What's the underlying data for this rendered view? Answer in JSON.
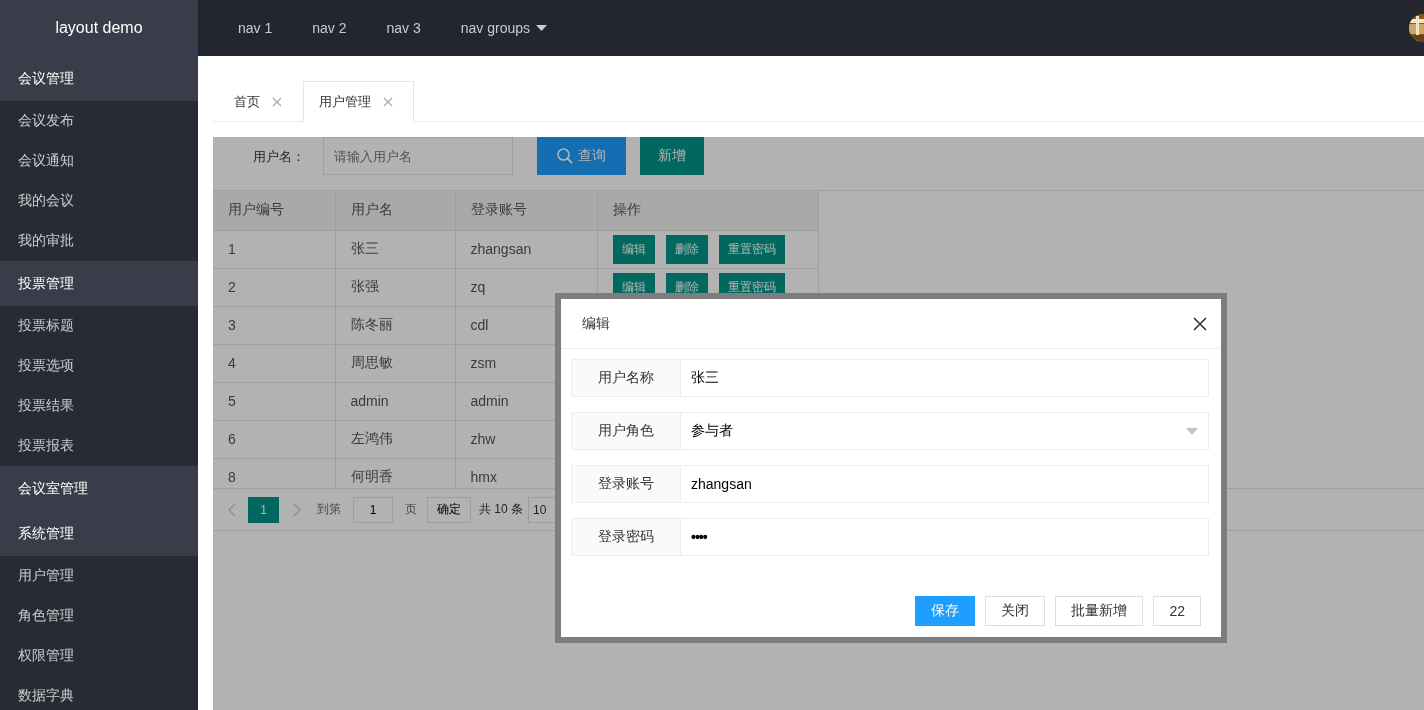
{
  "header": {
    "logo": "layout demo",
    "nav": [
      {
        "label": "nav 1",
        "kind": "link"
      },
      {
        "label": "nav 2",
        "kind": "link"
      },
      {
        "label": "nav 3",
        "kind": "link"
      },
      {
        "label": "nav groups",
        "kind": "dropdown"
      }
    ]
  },
  "sidebar": {
    "groups": [
      {
        "title": "会议管理",
        "items": [
          "会议发布",
          "会议通知",
          "我的会议",
          "我的审批"
        ]
      },
      {
        "title": "投票管理",
        "items": [
          "投票标题",
          "投票选项",
          "投票结果",
          "投票报表"
        ]
      },
      {
        "title": "会议室管理"
      },
      {
        "title": "系统管理",
        "items": [
          "用户管理",
          "角色管理",
          "权限管理",
          "数据字典"
        ]
      }
    ]
  },
  "tabs": [
    {
      "label": "首页",
      "selected": false
    },
    {
      "label": "用户管理",
      "selected": true
    }
  ],
  "search": {
    "label": "用户名：",
    "placeholder": "请输入用户名",
    "buttons": [
      {
        "label": "查询",
        "kind": "search"
      },
      {
        "label": "新增",
        "kind": "add"
      }
    ]
  },
  "table": {
    "columns": [
      "用户编号",
      "用户名",
      "登录账号",
      "操作"
    ],
    "rows": [
      {
        "cells": [
          "1",
          "张三",
          "zhangsan"
        ],
        "actions": [
          "编辑",
          "删除",
          "重置密码"
        ]
      },
      {
        "cells": [
          "2",
          "张强",
          "zq"
        ],
        "actions": [
          "编辑",
          "删除",
          "重置密码"
        ]
      },
      {
        "cells": [
          "3",
          "陈冬丽",
          "cdl"
        ]
      },
      {
        "cells": [
          "4",
          "周思敏",
          "zsm"
        ]
      },
      {
        "cells": [
          "5",
          "admin",
          "admin"
        ]
      },
      {
        "cells": [
          "6",
          "左鸿伟",
          "zhw"
        ]
      },
      {
        "cells": [
          "8",
          "何明香",
          "hmx"
        ]
      }
    ]
  },
  "pagination": {
    "pages": [
      {
        "label": "1",
        "selected": true
      }
    ],
    "goto_label": "到第",
    "goto_value": "1",
    "page_unit": "页",
    "confirm": "确定",
    "total": "共 10 条",
    "page_size": "10"
  },
  "dialog": {
    "title": "编辑",
    "fields": [
      {
        "label": "用户名称",
        "value": "张三",
        "kind": "text"
      },
      {
        "label": "用户角色",
        "value": "参与者",
        "kind": "select"
      },
      {
        "label": "登录账号",
        "value": "zhangsan",
        "kind": "text"
      },
      {
        "label": "登录密码",
        "value": "••••",
        "kind": "password"
      }
    ],
    "buttons": [
      {
        "label": "保存",
        "kind": "primary"
      },
      {
        "label": "关闭",
        "kind": "default"
      },
      {
        "label": "批量新增",
        "kind": "default"
      },
      {
        "label": "22",
        "kind": "default"
      }
    ]
  }
}
